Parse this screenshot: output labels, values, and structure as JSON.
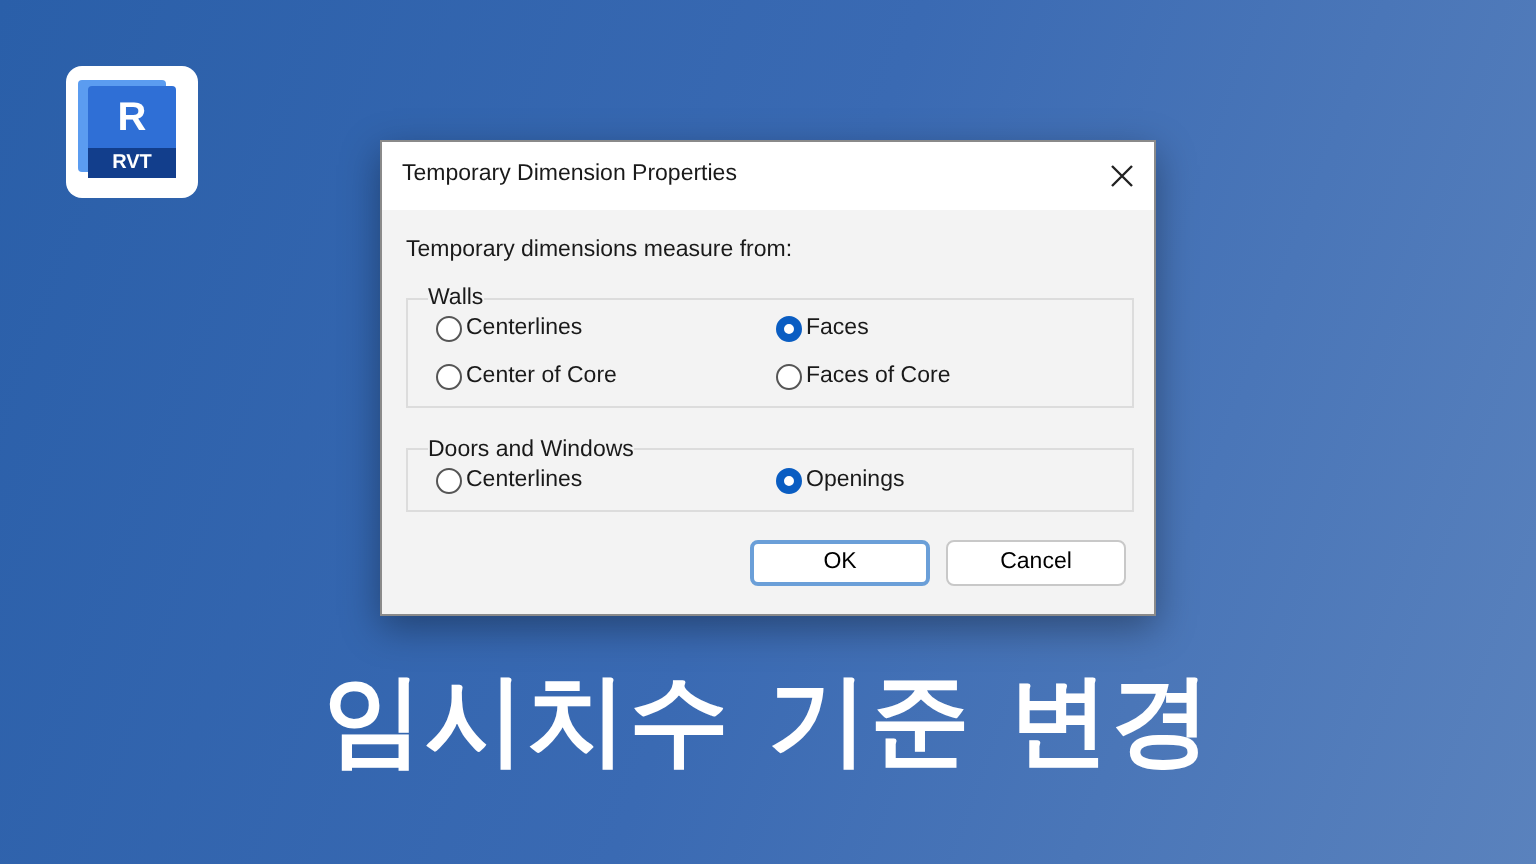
{
  "logo": {
    "letter": "R",
    "label": "RVT"
  },
  "dialog": {
    "title": "Temporary Dimension Properties",
    "prompt": "Temporary dimensions measure from:",
    "groups": [
      {
        "label": "Walls",
        "options": [
          {
            "label": "Centerlines",
            "selected": false
          },
          {
            "label": "Faces",
            "selected": true
          },
          {
            "label": "Center of Core",
            "selected": false
          },
          {
            "label": "Faces of Core",
            "selected": false
          }
        ]
      },
      {
        "label": "Doors and Windows",
        "options": [
          {
            "label": "Centerlines",
            "selected": false
          },
          {
            "label": "Openings",
            "selected": true
          }
        ]
      }
    ],
    "buttons": [
      {
        "label": "OK",
        "default": true
      },
      {
        "label": "Cancel",
        "default": false
      }
    ]
  },
  "headline": "임시치수 기준 변경"
}
